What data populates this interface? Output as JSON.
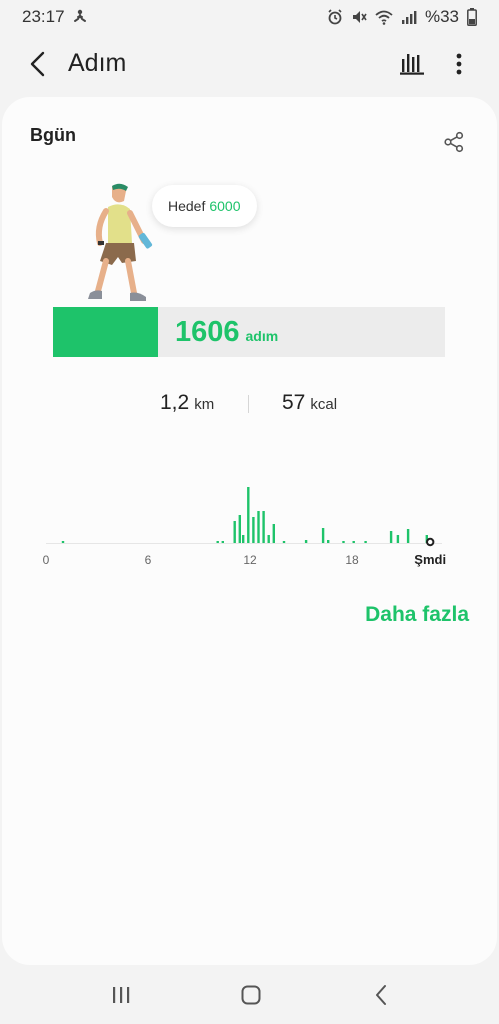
{
  "status_bar": {
    "time": "23:17",
    "battery": "%33",
    "icons": [
      "walking-icon",
      "alarm-icon",
      "mute-icon",
      "wifi-icon",
      "signal-icon",
      "battery-icon"
    ]
  },
  "app_bar": {
    "title": "Adım",
    "icons": [
      "back-arrow-icon",
      "bar-chart-icon",
      "more-vertical-icon"
    ]
  },
  "card": {
    "title": "Bgün",
    "share_icon": "share-icon",
    "goal_label": "Hedef",
    "goal_value": "6000",
    "steps_value": "1606",
    "steps_unit": "adım",
    "progress_fraction": 0.268,
    "distance_value": "1,2",
    "distance_unit": "km",
    "calories_value": "57",
    "calories_unit": "kcal",
    "more_link": "Daha fazla"
  },
  "chart_data": {
    "type": "bar",
    "xlabel": "",
    "ylabel": "",
    "x_ticks": [
      "0",
      "6",
      "12",
      "18",
      "Şmdi"
    ],
    "x_range": [
      0,
      24
    ],
    "x": [
      1.0,
      10.1,
      10.4,
      11.1,
      11.4,
      11.6,
      11.9,
      12.2,
      12.5,
      12.8,
      13.1,
      13.4,
      14.0,
      15.3,
      16.3,
      16.6,
      17.5,
      18.1,
      18.8,
      20.3,
      20.7,
      21.3,
      22.4
    ],
    "values": [
      2,
      2,
      2,
      22,
      28,
      8,
      56,
      26,
      32,
      32,
      8,
      19,
      2,
      3,
      15,
      3,
      2,
      2,
      2,
      12,
      8,
      14,
      8
    ],
    "current_x": 22.6,
    "colors": {
      "bar": "#1ec36a",
      "baseline": "#e6e6e6"
    }
  },
  "nav_bar": {
    "icons": [
      "recent-apps-icon",
      "home-icon",
      "back-icon"
    ]
  },
  "colors": {
    "accent": "#1ec36a",
    "background": "#f3f3f3",
    "card": "#fcfcfc",
    "track": "#ececec"
  }
}
